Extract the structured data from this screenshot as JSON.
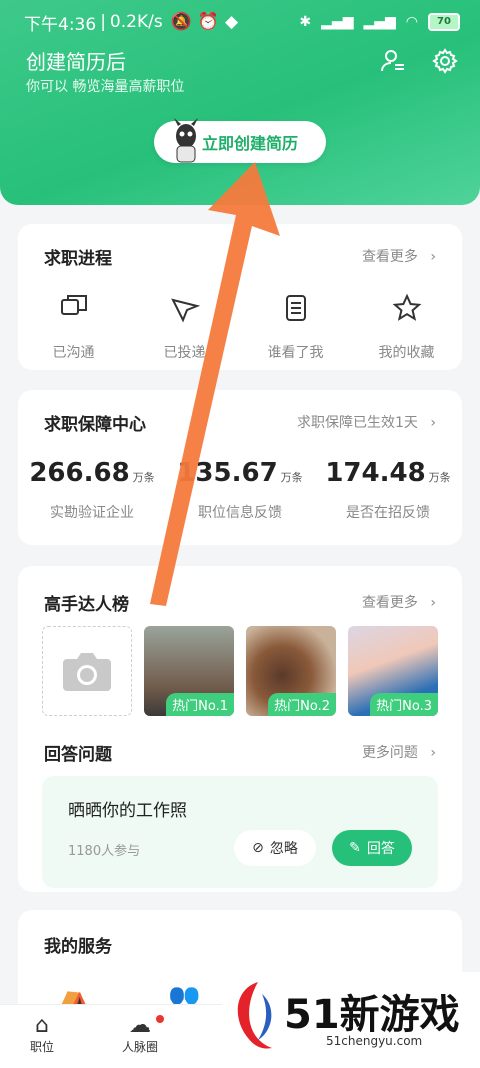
{
  "status": {
    "time": "下午4:36",
    "speed": "0.2K/s",
    "battery": "70"
  },
  "header": {
    "title": "创建简历后",
    "subtitle": "你可以 畅览海量高薪职位",
    "cta": "立即创建简历"
  },
  "progress": {
    "title": "求职进程",
    "more": "查看更多",
    "items": [
      {
        "label": "已沟通"
      },
      {
        "label": "已投递"
      },
      {
        "label": "谁看了我"
      },
      {
        "label": "我的收藏"
      }
    ]
  },
  "guarantee": {
    "title": "求职保障中心",
    "more": "求职保障已生效1天",
    "stats": [
      {
        "value": "266.68",
        "unit": "万条",
        "label": "实勘验证企业"
      },
      {
        "value": "135.67",
        "unit": "万条",
        "label": "职位信息反馈"
      },
      {
        "value": "174.48",
        "unit": "万条",
        "label": "是否在招反馈"
      }
    ]
  },
  "masters": {
    "title": "高手达人榜",
    "more": "查看更多",
    "tags": [
      "热门No.1",
      "热门No.2",
      "热门No.3"
    ]
  },
  "qa": {
    "title": "回答问题",
    "more": "更多问题",
    "question": "晒晒你的工作照",
    "count": "1180人参与",
    "ignore": "忽略",
    "answer": "回答"
  },
  "services": {
    "title": "我的服务"
  },
  "nav": {
    "jobs": "职位",
    "network": "人脉圈"
  },
  "watermark": {
    "brand": "51新游戏",
    "domain": "51chengyu.com"
  },
  "colors": {
    "accent": "#27c07a",
    "arrow": "#f47a3c"
  }
}
